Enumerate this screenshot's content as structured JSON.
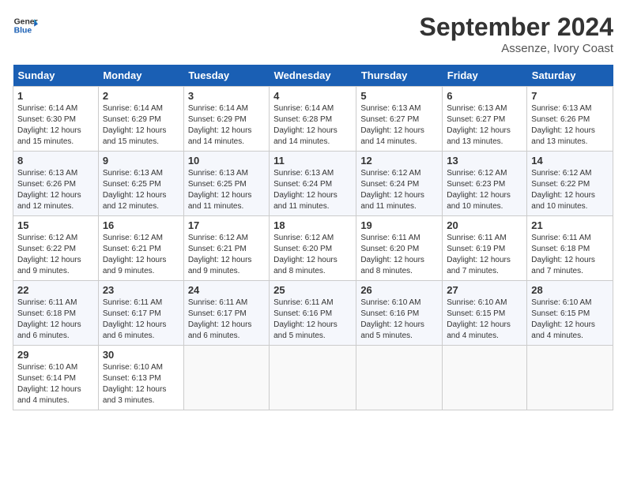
{
  "header": {
    "logo_line1": "General",
    "logo_line2": "Blue",
    "month": "September 2024",
    "location": "Assenze, Ivory Coast"
  },
  "weekdays": [
    "Sunday",
    "Monday",
    "Tuesday",
    "Wednesday",
    "Thursday",
    "Friday",
    "Saturday"
  ],
  "weeks": [
    [
      {
        "day": "1",
        "info": "Sunrise: 6:14 AM\nSunset: 6:30 PM\nDaylight: 12 hours\nand 15 minutes."
      },
      {
        "day": "2",
        "info": "Sunrise: 6:14 AM\nSunset: 6:29 PM\nDaylight: 12 hours\nand 15 minutes."
      },
      {
        "day": "3",
        "info": "Sunrise: 6:14 AM\nSunset: 6:29 PM\nDaylight: 12 hours\nand 14 minutes."
      },
      {
        "day": "4",
        "info": "Sunrise: 6:14 AM\nSunset: 6:28 PM\nDaylight: 12 hours\nand 14 minutes."
      },
      {
        "day": "5",
        "info": "Sunrise: 6:13 AM\nSunset: 6:27 PM\nDaylight: 12 hours\nand 14 minutes."
      },
      {
        "day": "6",
        "info": "Sunrise: 6:13 AM\nSunset: 6:27 PM\nDaylight: 12 hours\nand 13 minutes."
      },
      {
        "day": "7",
        "info": "Sunrise: 6:13 AM\nSunset: 6:26 PM\nDaylight: 12 hours\nand 13 minutes."
      }
    ],
    [
      {
        "day": "8",
        "info": "Sunrise: 6:13 AM\nSunset: 6:26 PM\nDaylight: 12 hours\nand 12 minutes."
      },
      {
        "day": "9",
        "info": "Sunrise: 6:13 AM\nSunset: 6:25 PM\nDaylight: 12 hours\nand 12 minutes."
      },
      {
        "day": "10",
        "info": "Sunrise: 6:13 AM\nSunset: 6:25 PM\nDaylight: 12 hours\nand 11 minutes."
      },
      {
        "day": "11",
        "info": "Sunrise: 6:13 AM\nSunset: 6:24 PM\nDaylight: 12 hours\nand 11 minutes."
      },
      {
        "day": "12",
        "info": "Sunrise: 6:12 AM\nSunset: 6:24 PM\nDaylight: 12 hours\nand 11 minutes."
      },
      {
        "day": "13",
        "info": "Sunrise: 6:12 AM\nSunset: 6:23 PM\nDaylight: 12 hours\nand 10 minutes."
      },
      {
        "day": "14",
        "info": "Sunrise: 6:12 AM\nSunset: 6:22 PM\nDaylight: 12 hours\nand 10 minutes."
      }
    ],
    [
      {
        "day": "15",
        "info": "Sunrise: 6:12 AM\nSunset: 6:22 PM\nDaylight: 12 hours\nand 9 minutes."
      },
      {
        "day": "16",
        "info": "Sunrise: 6:12 AM\nSunset: 6:21 PM\nDaylight: 12 hours\nand 9 minutes."
      },
      {
        "day": "17",
        "info": "Sunrise: 6:12 AM\nSunset: 6:21 PM\nDaylight: 12 hours\nand 9 minutes."
      },
      {
        "day": "18",
        "info": "Sunrise: 6:12 AM\nSunset: 6:20 PM\nDaylight: 12 hours\nand 8 minutes."
      },
      {
        "day": "19",
        "info": "Sunrise: 6:11 AM\nSunset: 6:20 PM\nDaylight: 12 hours\nand 8 minutes."
      },
      {
        "day": "20",
        "info": "Sunrise: 6:11 AM\nSunset: 6:19 PM\nDaylight: 12 hours\nand 7 minutes."
      },
      {
        "day": "21",
        "info": "Sunrise: 6:11 AM\nSunset: 6:18 PM\nDaylight: 12 hours\nand 7 minutes."
      }
    ],
    [
      {
        "day": "22",
        "info": "Sunrise: 6:11 AM\nSunset: 6:18 PM\nDaylight: 12 hours\nand 6 minutes."
      },
      {
        "day": "23",
        "info": "Sunrise: 6:11 AM\nSunset: 6:17 PM\nDaylight: 12 hours\nand 6 minutes."
      },
      {
        "day": "24",
        "info": "Sunrise: 6:11 AM\nSunset: 6:17 PM\nDaylight: 12 hours\nand 6 minutes."
      },
      {
        "day": "25",
        "info": "Sunrise: 6:11 AM\nSunset: 6:16 PM\nDaylight: 12 hours\nand 5 minutes."
      },
      {
        "day": "26",
        "info": "Sunrise: 6:10 AM\nSunset: 6:16 PM\nDaylight: 12 hours\nand 5 minutes."
      },
      {
        "day": "27",
        "info": "Sunrise: 6:10 AM\nSunset: 6:15 PM\nDaylight: 12 hours\nand 4 minutes."
      },
      {
        "day": "28",
        "info": "Sunrise: 6:10 AM\nSunset: 6:15 PM\nDaylight: 12 hours\nand 4 minutes."
      }
    ],
    [
      {
        "day": "29",
        "info": "Sunrise: 6:10 AM\nSunset: 6:14 PM\nDaylight: 12 hours\nand 4 minutes."
      },
      {
        "day": "30",
        "info": "Sunrise: 6:10 AM\nSunset: 6:13 PM\nDaylight: 12 hours\nand 3 minutes."
      },
      {
        "day": "",
        "info": ""
      },
      {
        "day": "",
        "info": ""
      },
      {
        "day": "",
        "info": ""
      },
      {
        "day": "",
        "info": ""
      },
      {
        "day": "",
        "info": ""
      }
    ]
  ]
}
